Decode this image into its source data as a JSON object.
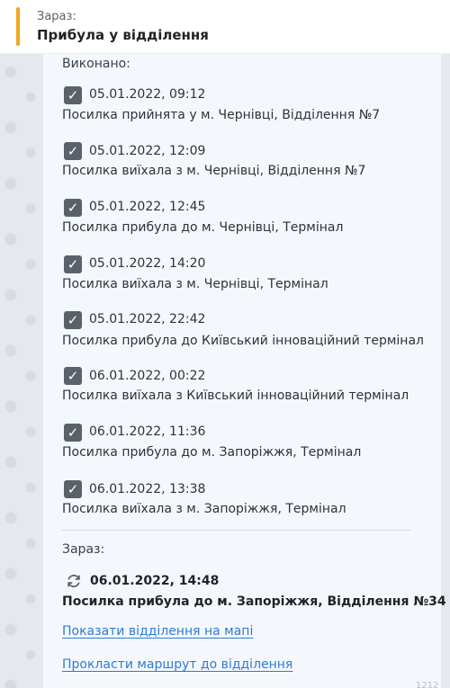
{
  "header": {
    "label": "Зараз:",
    "title": "Прибула у відділення"
  },
  "done_label": "Виконано:",
  "events": [
    {
      "time": "05.01.2022, 09:12",
      "desc": "Посилка прийнята у м. Чернівці, Відділення №7"
    },
    {
      "time": "05.01.2022, 12:09",
      "desc": "Посилка виїхала з м. Чернівці, Відділення №7"
    },
    {
      "time": "05.01.2022, 12:45",
      "desc": "Посилка прибула до м. Чернівці, Термінал"
    },
    {
      "time": "05.01.2022, 14:20",
      "desc": "Посилка виїхала з м. Чернівці, Термінал"
    },
    {
      "time": "05.01.2022, 22:42",
      "desc": "Посилка прибула до Київський інноваційний термінал"
    },
    {
      "time": "06.01.2022, 00:22",
      "desc": "Посилка виїхала з Київський інноваційний термінал"
    },
    {
      "time": "06.01.2022, 11:36",
      "desc": "Посилка прибула до м. Запоріжжя, Термінал"
    },
    {
      "time": "06.01.2022, 13:38",
      "desc": "Посилка виїхала з м. Запоріжжя, Термінал"
    }
  ],
  "current": {
    "label": "Зараз:",
    "time": "06.01.2022, 14:48",
    "desc": "Посилка прибула до м. Запоріжжя, Відділення №34"
  },
  "links": {
    "show_on_map": "Показати відділення на мапі",
    "route": "Прокласти маршрут до відділення"
  },
  "corner_text": "1212"
}
